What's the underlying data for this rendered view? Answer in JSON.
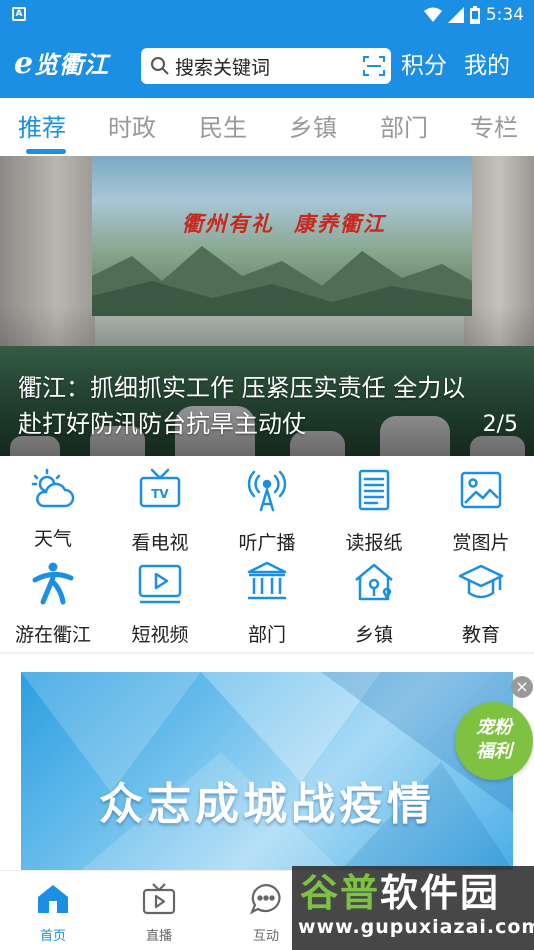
{
  "status_bar": {
    "time": "5:34",
    "notification_icon": "a-letter-icon"
  },
  "header": {
    "logo_e": "e",
    "logo_text": "览衢江",
    "search_placeholder": "搜索关键词",
    "points_label": "积分",
    "mine_label": "我的"
  },
  "tabs": [
    {
      "label": "推荐",
      "active": true
    },
    {
      "label": "时政",
      "active": false
    },
    {
      "label": "民生",
      "active": false
    },
    {
      "label": "乡镇",
      "active": false
    },
    {
      "label": "部门",
      "active": false
    },
    {
      "label": "专栏",
      "active": false
    }
  ],
  "banner": {
    "slogan_1": "衢州有礼",
    "slogan_2": "康养衢江",
    "title": "衢江：抓细抓实工作 压紧压实责任 全力以赴打好防汛防台抗旱主动仗",
    "pager": "2/5"
  },
  "grid": [
    {
      "label": "天气",
      "icon": "weather-icon"
    },
    {
      "label": "看电视",
      "icon": "tv-icon"
    },
    {
      "label": "听广播",
      "icon": "radio-icon"
    },
    {
      "label": "读报纸",
      "icon": "newspaper-icon"
    },
    {
      "label": "赏图片",
      "icon": "picture-icon"
    },
    {
      "label": "游在衢江",
      "icon": "travel-icon"
    },
    {
      "label": "短视频",
      "icon": "video-icon"
    },
    {
      "label": "部门",
      "icon": "department-icon"
    },
    {
      "label": "乡镇",
      "icon": "township-icon"
    },
    {
      "label": "教育",
      "icon": "education-icon"
    }
  ],
  "ad": {
    "text": "众志成城战疫情",
    "close": "×",
    "badge_line1": "宠粉",
    "badge_line2": "福利"
  },
  "bottom_nav": [
    {
      "label": "首页",
      "icon": "home-icon",
      "active": true
    },
    {
      "label": "直播",
      "icon": "live-icon",
      "active": false
    },
    {
      "label": "互动",
      "icon": "chat-icon",
      "active": false
    }
  ],
  "watermark": {
    "text_1": "谷普",
    "text_2": "软件园",
    "url": "www.gupuxiazai.com"
  },
  "colors": {
    "primary": "#1a8fe3",
    "tab_inactive": "#999999",
    "badge_green": "#7fc241"
  }
}
